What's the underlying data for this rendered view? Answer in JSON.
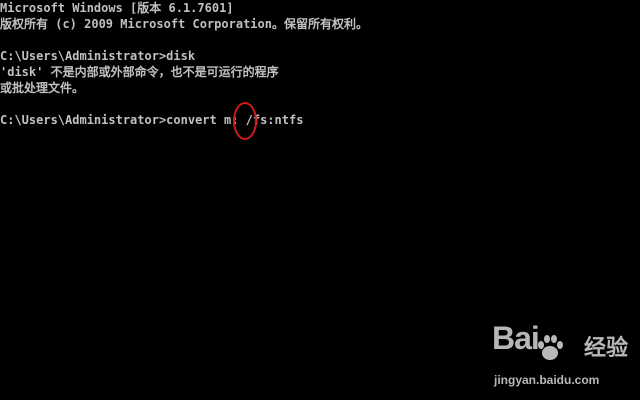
{
  "console": {
    "lines": [
      "Microsoft Windows [版本 6.1.7601]",
      "版权所有 (c) 2009 Microsoft Corporation。保留所有权利。",
      "C:\\Users\\Administrator>disk",
      "'disk' 不是内部或外部命令，也不是可运行的程序",
      "或批处理文件。",
      "C:\\Users\\Administrator>convert m: /fs:ntfs"
    ]
  },
  "watermark": {
    "logo_prefix": "Bai",
    "logo_suffix": "经验",
    "url": "jingyan.baidu.com"
  },
  "colors": {
    "background": "#000000",
    "text": "#c0c0c0",
    "annotation": "#d01c1c"
  }
}
